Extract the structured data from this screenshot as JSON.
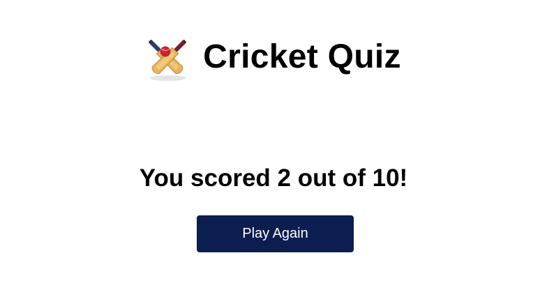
{
  "header": {
    "logo_icon": "crossed-cricket-bats-icon",
    "title": "Cricket Quiz"
  },
  "result": {
    "score_text": "You scored 2 out of 10!"
  },
  "actions": {
    "play_again_label": "Play Again"
  },
  "colors": {
    "button_background": "#0c1d4f",
    "button_text": "#ffffff",
    "text": "#000000",
    "background": "#ffffff"
  }
}
